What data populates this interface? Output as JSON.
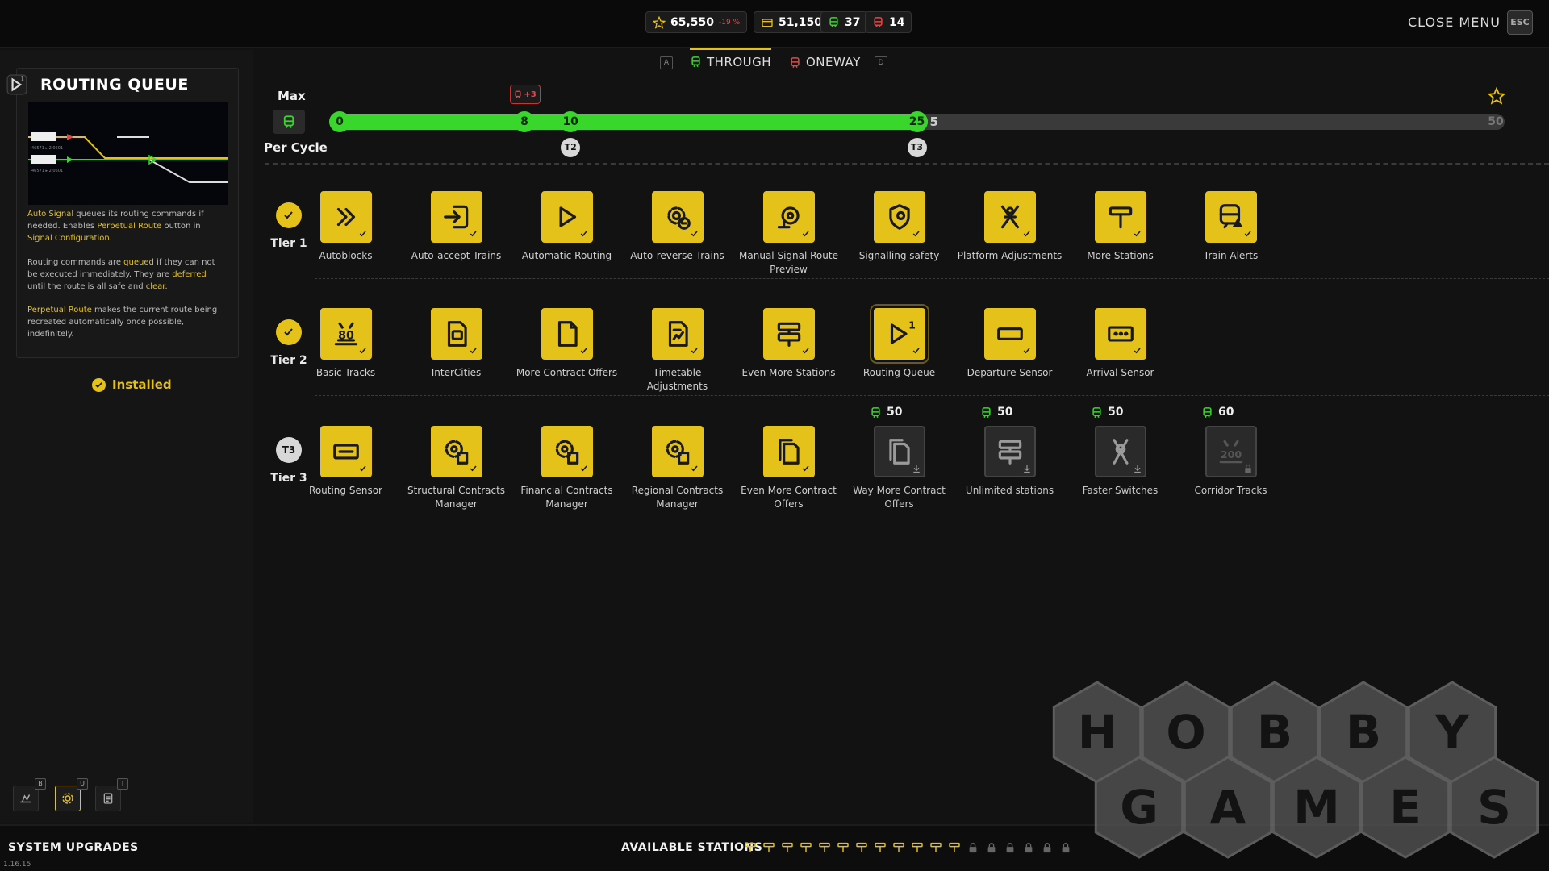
{
  "stats": {
    "reputation": "65,550",
    "reputation_delta": "-19 %",
    "money": "51,150",
    "green_trains": "37",
    "red_trains": "14"
  },
  "header": {
    "close_label": "CLOSE MENU",
    "esc_key": "ESC"
  },
  "tabs": {
    "left_key": "A",
    "right_key": "D",
    "items": [
      {
        "label": "THROUGH",
        "active": true,
        "color": "#3fd63a"
      },
      {
        "label": "ONEWAY",
        "active": false,
        "color": "#e04848"
      }
    ]
  },
  "detail": {
    "title": "ROUTING QUEUE",
    "para1": [
      "Auto Signal",
      " queues its routing commands if needed. Enables ",
      "Perpetual Route",
      " button in ",
      "Signal Configuration",
      "."
    ],
    "para2": [
      "Routing commands are ",
      "queued",
      " if they can not be executed immediately. They are ",
      "deferred",
      " until the route is all safe and ",
      "clear",
      "."
    ],
    "para3": [
      "Perpetual Route",
      " makes the current route being recreated automatically once possible, indefinitely."
    ],
    "status": "Installed",
    "preview_codes": [
      "46571 ▸ 2·0601",
      "46571 ▸ 2·0601"
    ]
  },
  "slider": {
    "top_label": "Max",
    "bottom_label": "Per Cycle",
    "min": 0,
    "max": 50,
    "value": 25,
    "remaining_label": "5",
    "max_label": "50",
    "bonus_label": "+3",
    "nodes": [
      {
        "value": 0,
        "label": "0"
      },
      {
        "value": 8,
        "label": "8"
      },
      {
        "value": 10,
        "label": "10"
      },
      {
        "value": 25,
        "label": "25"
      }
    ],
    "tier_marks": [
      {
        "value": 10,
        "label": "T2"
      },
      {
        "value": 25,
        "label": "T3"
      }
    ]
  },
  "tiers": [
    {
      "label": "Tier 1",
      "status": "done",
      "items": [
        {
          "name": "Autoblocks",
          "icon": "double-chevron-icon",
          "state": "on"
        },
        {
          "name": "Auto-accept Trains",
          "icon": "enter-arrow-icon",
          "state": "on"
        },
        {
          "name": "Automatic Routing",
          "icon": "play-icon",
          "state": "on"
        },
        {
          "name": "Auto-reverse Trains",
          "icon": "gear-cycle-icon",
          "state": "on"
        },
        {
          "name": "Manual Signal Route Preview",
          "icon": "signal-eye-icon",
          "state": "on"
        },
        {
          "name": "Signalling safety",
          "icon": "shield-signal-icon",
          "state": "on"
        },
        {
          "name": "Platform Adjustments",
          "icon": "platform-icon",
          "state": "on"
        },
        {
          "name": "More Stations",
          "icon": "station-sign-icon",
          "state": "on"
        },
        {
          "name": "Train Alerts",
          "icon": "train-alert-icon",
          "state": "on"
        }
      ]
    },
    {
      "label": "Tier 2",
      "status": "done",
      "items": [
        {
          "name": "Basic Tracks",
          "icon": "speed-80-icon",
          "state": "on",
          "icon_text": "80"
        },
        {
          "name": "InterCities",
          "icon": "intercity-doc-icon",
          "state": "on"
        },
        {
          "name": "More Contract Offers",
          "icon": "document-icon",
          "state": "on"
        },
        {
          "name": "Timetable Adjustments",
          "icon": "timetable-icon",
          "state": "on"
        },
        {
          "name": "Even More Stations",
          "icon": "double-sign-icon",
          "state": "on"
        },
        {
          "name": "Routing Queue",
          "icon": "routing-queue-icon",
          "state": "on",
          "selected": true
        },
        {
          "name": "Departure Sensor",
          "icon": "sensor-rect-icon",
          "state": "on"
        },
        {
          "name": "Arrival Sensor",
          "icon": "sensor-dots-icon",
          "state": "on"
        }
      ]
    },
    {
      "label": "Tier 3",
      "status": "locked",
      "badge": "T3",
      "items": [
        {
          "name": "Routing Sensor",
          "icon": "routing-sensor-icon",
          "state": "on"
        },
        {
          "name": "Structural Contracts Manager",
          "icon": "gear-doc-icon",
          "state": "on"
        },
        {
          "name": "Financial Contracts Manager",
          "icon": "gear-doc-icon",
          "state": "on"
        },
        {
          "name": "Regional Contracts Manager",
          "icon": "gear-doc-icon",
          "state": "on"
        },
        {
          "name": "Even More Contract Offers",
          "icon": "documents-icon",
          "state": "on"
        },
        {
          "name": "Way More Contract Offers",
          "icon": "documents-icon",
          "state": "off",
          "cost": "50"
        },
        {
          "name": "Unlimited stations",
          "icon": "double-sign-icon",
          "state": "off",
          "cost": "50"
        },
        {
          "name": "Faster Switches",
          "icon": "switch-icon",
          "state": "off",
          "cost": "50"
        },
        {
          "name": "Corridor Tracks",
          "icon": "speed-200-icon",
          "state": "locked",
          "cost": "60",
          "icon_text": "200"
        }
      ]
    }
  ],
  "bottom": {
    "section": "SYSTEM UPGRADES",
    "version": "1.16.15",
    "stations_label": "AVAILABLE STATIONS",
    "stations_available": 12,
    "stations_locked": 6,
    "mini_keys": [
      "B",
      "U",
      "I"
    ]
  },
  "watermark": {
    "line1": [
      "H",
      "O",
      "B",
      "B",
      "Y"
    ],
    "line2": [
      "G",
      "A",
      "M",
      "E",
      "S"
    ]
  },
  "colors": {
    "accent": "#e5c21a",
    "green": "#39d62b",
    "red": "#e04848"
  }
}
